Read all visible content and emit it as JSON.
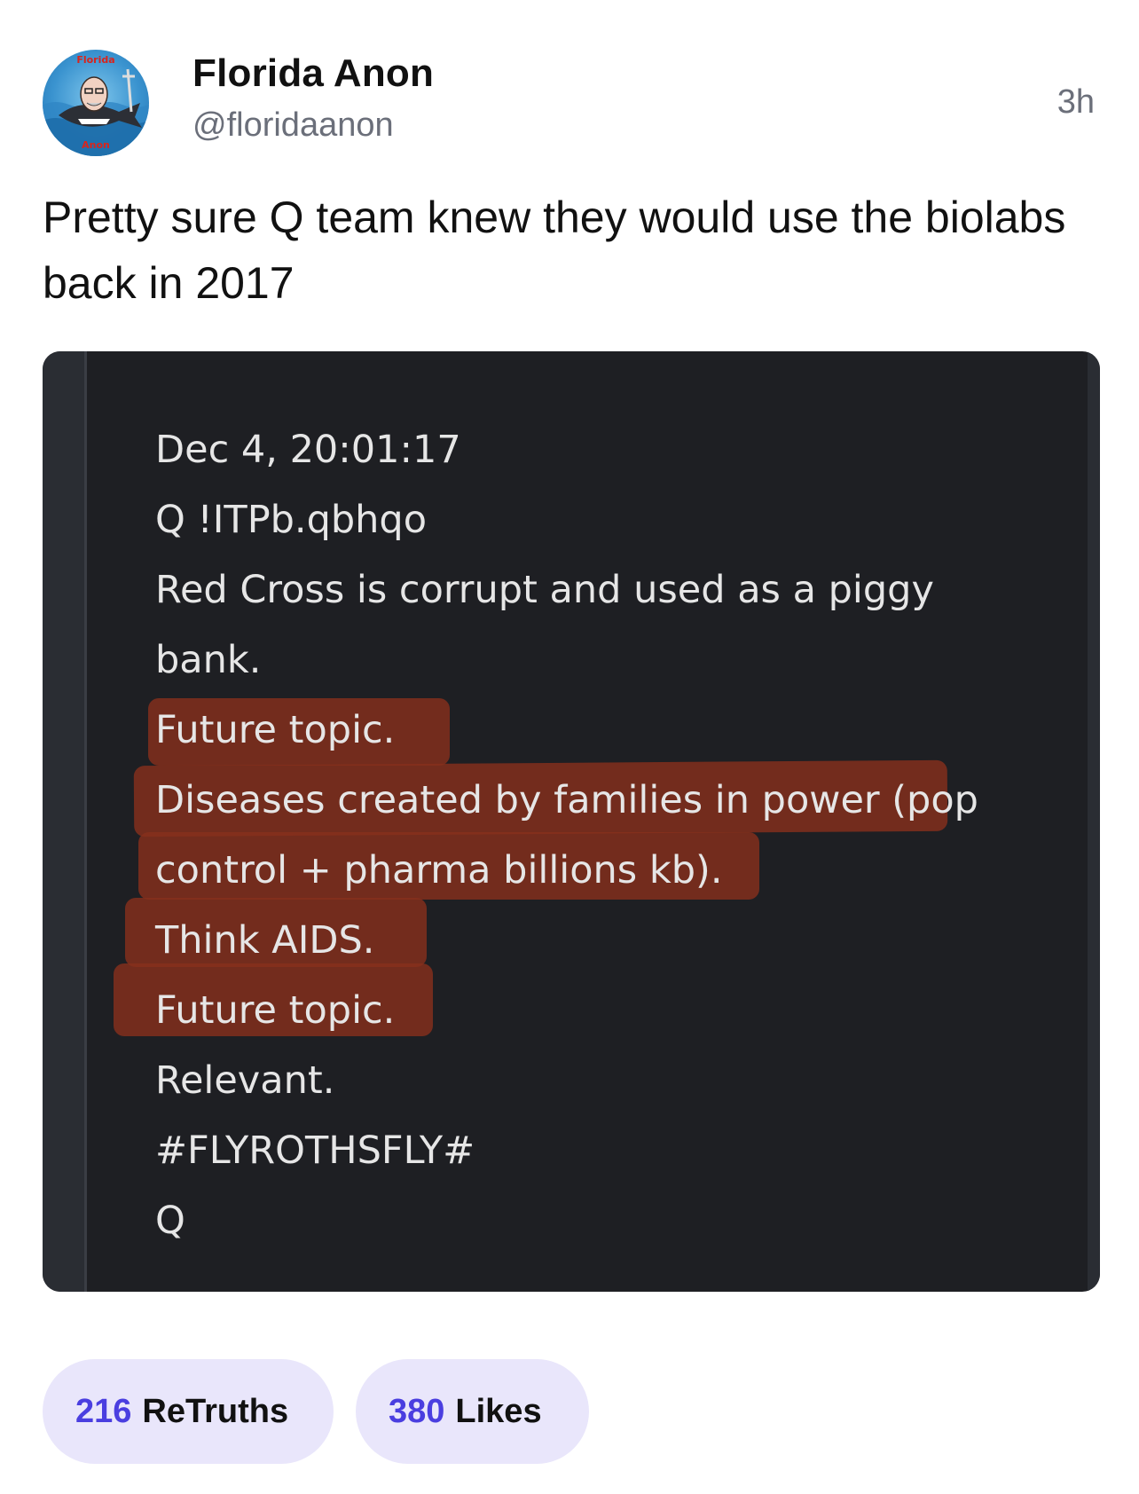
{
  "author": {
    "display_name": "Florida Anon",
    "handle": "@floridaanon",
    "avatar_icon": "florida-anon-avatar",
    "avatar_text_top": "Florida",
    "avatar_text_bottom": "Anon"
  },
  "post": {
    "time_ago": "3h",
    "text": "Pretty sure Q team knew they would use the biolabs back in 2017"
  },
  "media": {
    "lines": [
      "Dec 4, 20:01:17",
      "Q !ITPb.qbhqo",
      "Red Cross is corrupt and used as a piggy",
      "bank.",
      "Future topic.",
      "Diseases created by families in power (pop",
      "control + pharma billions kb).",
      "Think AIDS.",
      "Future topic.",
      "Relevant.",
      "#FLYROTHSFLY#",
      "Q"
    ],
    "highlighted_lines": [
      4,
      5,
      6,
      7,
      8
    ],
    "highlight_color": "#86301c",
    "background_color": "#1e1f23"
  },
  "actions": {
    "retruths_count": "216",
    "retruths_label": "ReTruths",
    "likes_count": "380",
    "likes_label": "Likes",
    "accent_color": "#4a3ee0",
    "pill_color": "#e9e6fb"
  }
}
